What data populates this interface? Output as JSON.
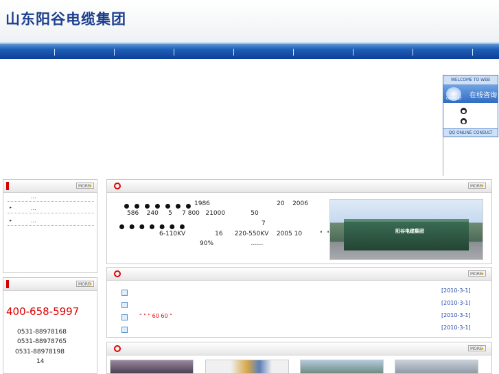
{
  "header": {
    "logo_text": "山东阳谷电缆集团"
  },
  "qq": {
    "top_label": "WELCOME TO WEB",
    "button_text": "在线咨询",
    "button_sub": "CONSULT",
    "bottom_label": "QQ ONLINE CONSULT"
  },
  "more_label": "MORE",
  "news_left": {
    "ellipsis": [
      "…",
      "…",
      "…"
    ]
  },
  "contact": {
    "hotline": "400-658-5997",
    "phones": [
      "0531-88978168",
      "0531-88978765",
      "0531-88978198"
    ],
    "extra": "14"
  },
  "intro": {
    "lines": [
      "1986                                  20    2006",
      "586    240     5     7 800   21000             50",
      "7",
      "6-110KV               16      220-550KV    2005 10         \"  \"",
      "90%                   ……"
    ],
    "image_sign": "阳谷电缆集团"
  },
  "news_list": {
    "dates": [
      "[2010-3-1]",
      "[2010-3-1]",
      "[2010-3-1]",
      "[2010-3-1]"
    ],
    "red_text": "\" \"  \" 60 60 \""
  },
  "colors": {
    "nav_blue": "#1e5fb8",
    "accent_red": "#e00000",
    "date_blue": "#1c3fa8"
  }
}
